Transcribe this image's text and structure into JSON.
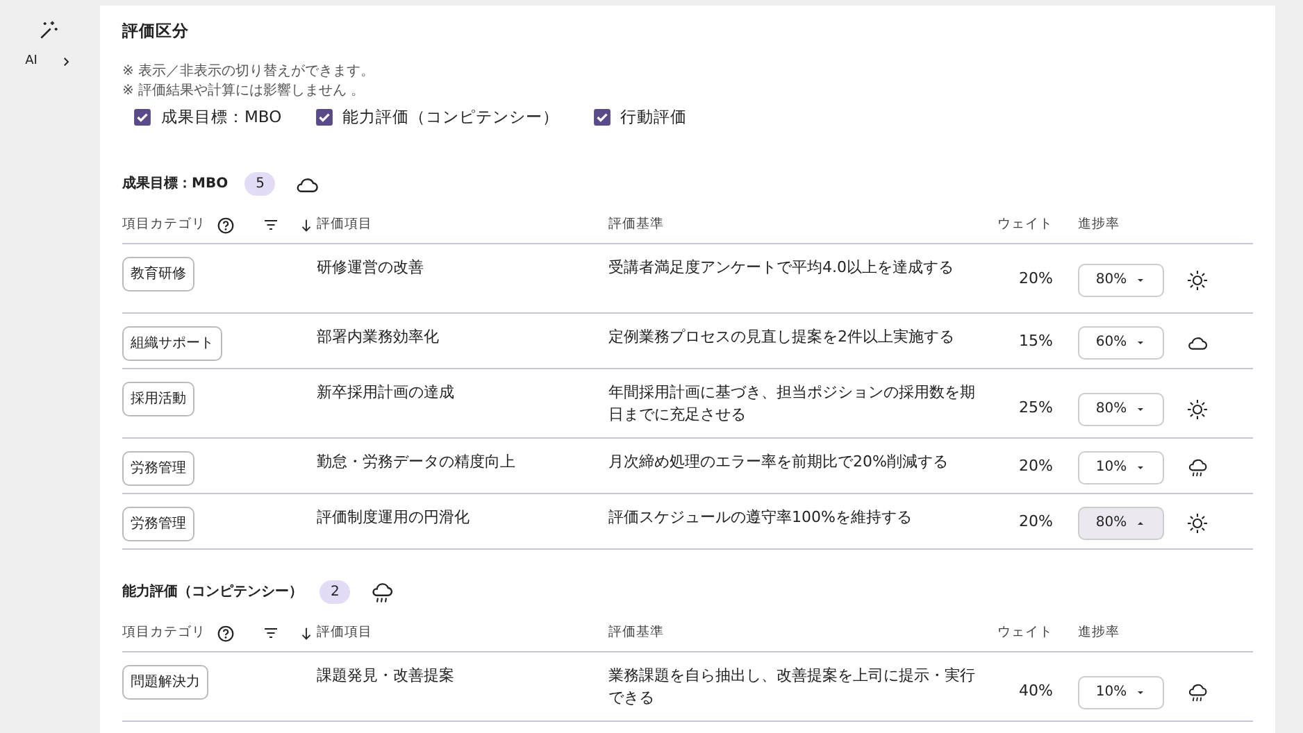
{
  "sidebar": {
    "items": [
      {
        "label": "AI",
        "expanded": false
      }
    ]
  },
  "title": "評価区分",
  "notes": [
    "※ 表示／非表示の切り替えができます。",
    "※ 評価結果や計算には影響しません 。"
  ],
  "toggles": [
    {
      "label": "成果目標：MBO",
      "checked": true
    },
    {
      "label": "能力評価（コンピテンシー）",
      "checked": true
    },
    {
      "label": "行動評価",
      "checked": true
    }
  ],
  "sections": [
    {
      "title": "成果目標：MBO",
      "count": "5",
      "status": {
        "kind": "cloudy"
      },
      "columns": [
        "項目カテゴリ",
        "評価項目",
        "評価基準",
        "ウェイト",
        "進捗率"
      ],
      "rows": [
        {
          "category": "教育研修",
          "item": "研修運営の改善",
          "criteria": "受講者満足度アンケートで平均4.0以上を達成する",
          "weight": "20%",
          "progress": "80%",
          "open": false,
          "status": {
            "kind": "sunny"
          }
        },
        {
          "category": "組織サポート",
          "item": "部署内業務効率化",
          "criteria": "定例業務プロセスの見直し提案を2件以上実施する",
          "weight": "15%",
          "progress": "60%",
          "open": false,
          "status": {
            "kind": "cloudy"
          }
        },
        {
          "category": "採用活動",
          "item": "新卒採用計画の達成",
          "criteria": "年間採用計画に基づき、担当ポジションの採用数を期日までに充足させる",
          "weight": "25%",
          "progress": "80%",
          "open": false,
          "status": {
            "kind": "sunny"
          }
        },
        {
          "category": "労務管理",
          "item": "勤怠・労務データの精度向上",
          "criteria": "月次締め処理のエラー率を前期比で20%削減する",
          "weight": "20%",
          "progress": "10%",
          "open": false,
          "status": {
            "kind": "rainy"
          }
        },
        {
          "category": "労務管理",
          "item": "評価制度運用の円滑化",
          "criteria": "評価スケジュールの遵守率100%を維持する",
          "weight": "20%",
          "progress": "80%",
          "open": true,
          "status": {
            "kind": "sunny"
          }
        }
      ]
    },
    {
      "title": "能力評価（コンピテンシー）",
      "count": "2",
      "status": {
        "kind": "rainy"
      },
      "columns": [
        "項目カテゴリ",
        "評価項目",
        "評価基準",
        "ウェイト",
        "進捗率"
      ],
      "rows": [
        {
          "category": "問題解決力",
          "item": "課題発見・改善提案",
          "criteria": "業務課題を自ら抽出し、改善提案を上司に提示・実行できる",
          "weight": "40%",
          "progress": "10%",
          "open": false,
          "status": {
            "kind": "rainy"
          }
        }
      ]
    }
  ]
}
